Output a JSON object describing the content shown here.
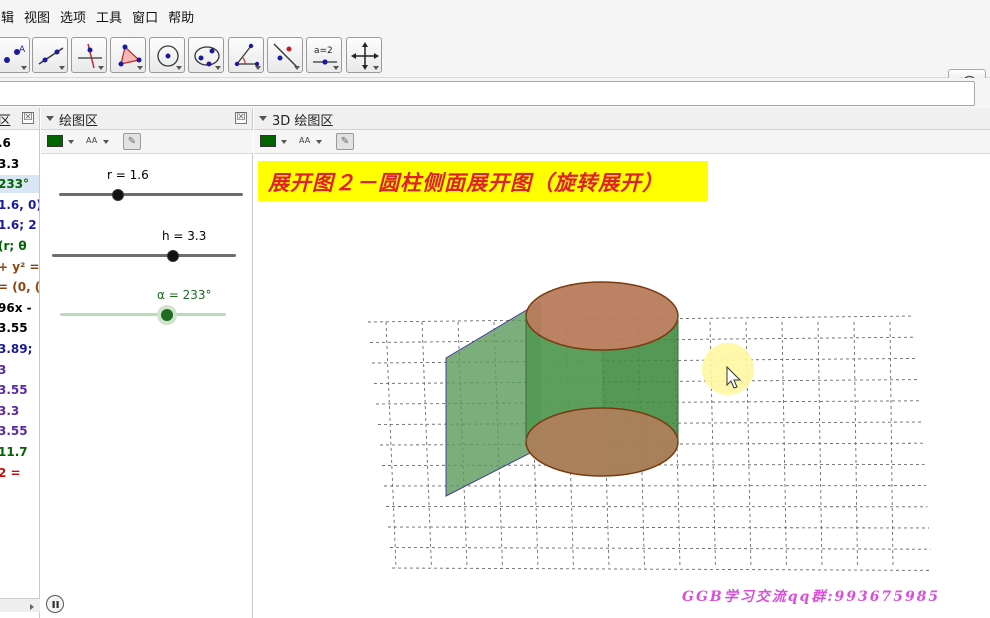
{
  "menu": [
    "编辑",
    "视图",
    "选项",
    "工具",
    "窗口",
    "帮助"
  ],
  "menu_partial_first": "辑",
  "toolbar": {
    "tools": [
      "point-tool",
      "line-tool",
      "perpendicular-tool",
      "polygon-tool",
      "circle-tool",
      "conic-tool",
      "angle-tool",
      "reflect-tool",
      "slider-tool",
      "move-view-tool"
    ],
    "slider_tool_label": "a=2"
  },
  "help_glyph": "?",
  "algebra_view": {
    "header_partial": "区",
    "rows": [
      {
        "text": ".6",
        "color": "#000000"
      },
      {
        "text": "3.3",
        "color": "#000000"
      },
      {
        "text": "233°",
        "color": "#006400",
        "selected": true
      },
      {
        "text": "1.6, 0)",
        "color": "#1a1aa0"
      },
      {
        "text": "1.6; 2",
        "color": "#1a1aa0"
      },
      {
        "text": "(r; θ",
        "color": "#006400"
      },
      {
        "text": "+ y² =",
        "color": "#8b4513"
      },
      {
        "text": "= (0, (",
        "color": "#8b4513"
      },
      {
        "text": "96x -",
        "color": "#000000"
      },
      {
        "text": "3.55",
        "color": "#000000"
      },
      {
        "text": "3.89;",
        "color": "#1a1aa0"
      },
      {
        "text": "3",
        "color": "#5a2aa0"
      },
      {
        "text": "3.55",
        "color": "#5a2aa0"
      },
      {
        "text": "3.3",
        "color": "#5a2aa0"
      },
      {
        "text": "3.55",
        "color": "#5a2aa0"
      },
      {
        "text": "11.7",
        "color": "#006400"
      },
      {
        "text": "2 =",
        "color": "#c01010"
      }
    ]
  },
  "graphics_view": {
    "header": "绘图区",
    "close": "☒",
    "aa_label": "AA",
    "sliders": [
      {
        "label": "r = 1.6",
        "value": 1.6,
        "min": 0,
        "max": 5,
        "color": "#000000"
      },
      {
        "label": "h = 3.3",
        "value": 3.3,
        "min": 0,
        "max": 5,
        "color": "#000000"
      },
      {
        "label": "α = 233°",
        "value": 233,
        "min": 0,
        "max": 360,
        "color": "#1f6b1f"
      }
    ]
  },
  "view_3d": {
    "header": "3D 绘图区",
    "aa_label": "AA",
    "title": "展开图２－圆柱侧面展开图（旋转展开）",
    "footer": "GGB学习交流qq群:993675985"
  },
  "colors": {
    "title_bg": "#ffff00",
    "title_text": "#e0202a",
    "cylinder_side": "#2f7d2f",
    "cylinder_cap": "#b77b5b",
    "unrolled_sheet": "#5a9a5a",
    "footer_text": "#d94fd9"
  }
}
